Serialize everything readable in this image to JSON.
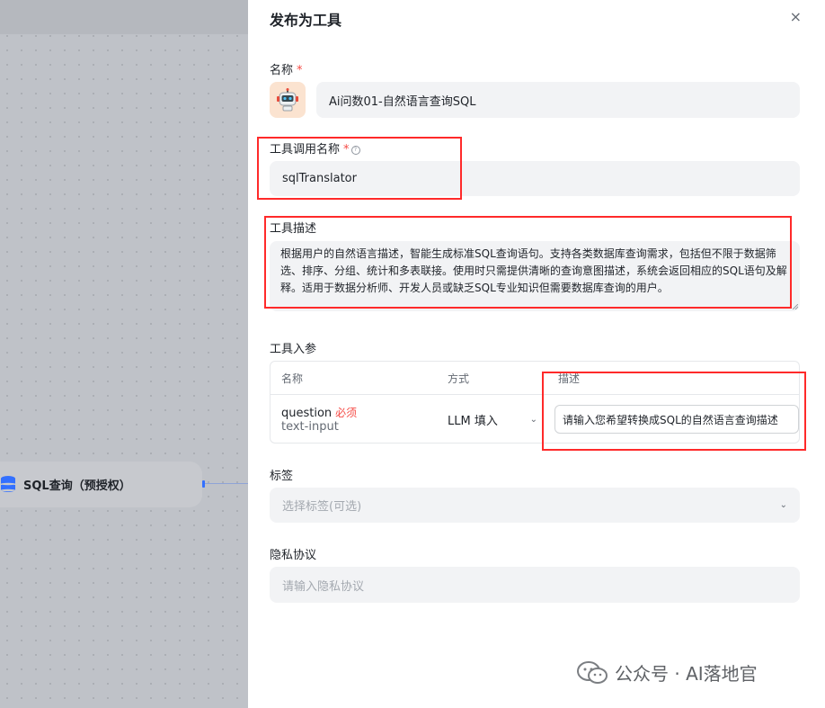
{
  "canvas": {
    "node_label": "SQL查询（预授权）"
  },
  "drawer": {
    "title": "发布为工具",
    "close_icon": "×"
  },
  "form": {
    "name_label": "名称",
    "required_mark": "*",
    "name_value": "Ai问数01-自然语言查询SQL",
    "tool_call_name_label": "工具调用名称",
    "tool_call_name_value": "sqlTranslator",
    "help_icon": "?",
    "description_label": "工具描述",
    "description_value": "根据用户的自然语言描述，智能生成标准SQL查询语句。支持各类数据库查询需求，包括但不限于数据筛选、排序、分组、统计和多表联接。使用时只需提供清晰的查询意图描述，系统会返回相应的SQL语句及解释。适用于数据分析师、开发人员或缺乏SQL专业知识但需要数据库查询的用户。",
    "params_label": "工具入参",
    "params_table": {
      "headers": [
        "名称",
        "方式",
        "描述"
      ],
      "rows": [
        {
          "name": "question",
          "required": "必须",
          "type": "text-input",
          "method": "LLM 填入",
          "description": "请输入您希望转换成SQL的自然语言查询描述"
        }
      ]
    },
    "tags_label": "标签",
    "tags_placeholder": "选择标签(可选)",
    "privacy_label": "隐私协议",
    "privacy_placeholder": "请输入隐私协议"
  },
  "watermark": {
    "text": "公众号 · AI落地官"
  },
  "colors": {
    "annotation_red": "#ff2a2a",
    "required_red": "#f54a45",
    "input_bg": "#f2f3f5"
  }
}
